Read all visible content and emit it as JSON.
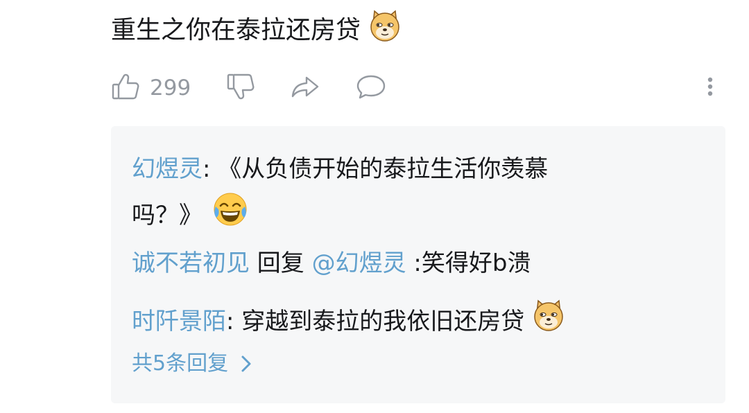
{
  "comment": {
    "text": "重生之你在泰拉还房贷",
    "emoji": "doge-emoji"
  },
  "actions": {
    "like_count": "299",
    "icons": [
      "thumb-up-icon",
      "thumb-down-icon",
      "share-icon",
      "reply-icon",
      "more-icon"
    ]
  },
  "replies": [
    {
      "user": "幻煜灵",
      "sep": ": ",
      "line1": "《从负债开始的泰拉生活你羡慕",
      "line2": "吗？》",
      "emoji": "laughing-tears-emoji"
    },
    {
      "user": "诚不若初见",
      "reply_word": " 回复 ",
      "mention": "@幻煜灵",
      "text": " :笑得好b溃"
    },
    {
      "user": "时阡景陌",
      "sep": ": ",
      "text": "穿越到泰拉的我依旧还房贷",
      "emoji": "doge-emoji"
    }
  ],
  "view_more": {
    "label": "共5条回复"
  },
  "colors": {
    "username": "#61a0cd",
    "icon_gray": "#9499a0",
    "reply_bg": "#f6f7f8"
  }
}
